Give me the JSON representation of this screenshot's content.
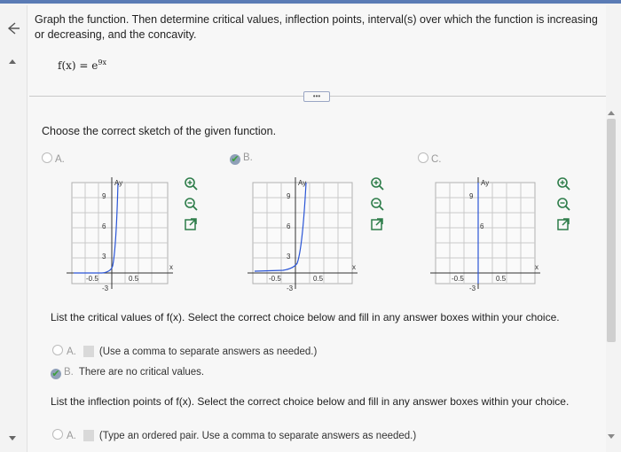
{
  "question_text": "Graph the function. Then determine critical values, inflection points, interval(s) over which the function is increasing or decreasing, and the concavity.",
  "function": {
    "base": "f(x) = e",
    "exponent": "9x"
  },
  "more_button": "•••",
  "sketch_prompt": "Choose the correct sketch of the given function.",
  "sketch_options": [
    {
      "letter": "A.",
      "selected": false
    },
    {
      "letter": "B.",
      "selected": true
    },
    {
      "letter": "C.",
      "selected": false
    }
  ],
  "graph_labels": {
    "y_top": "9",
    "y_mid": "6",
    "y_low": "3",
    "y_neg": "-3",
    "x_neg": "-0.5",
    "x_pos": "0.5",
    "x_axis": "x",
    "y_axis": "Ay"
  },
  "critical_prompt": "List the critical values of f(x). Select the correct choice below and fill in any answer boxes within your choice.",
  "critical_choices": [
    {
      "letter": "A.",
      "text": "(Use a comma to separate answers as needed.)"
    },
    {
      "letter": "B.",
      "text": "There are no critical values."
    }
  ],
  "inflection_prompt": "List the inflection points of f(x). Select the correct choice below and fill in any answer boxes within your choice.",
  "inflection_choices": [
    {
      "letter": "A.",
      "text": "(Type an ordered pair. Use a comma to separate answers as needed.)"
    }
  ],
  "colors": {
    "curve": "#2a55d6",
    "grid": "#c8c8c8",
    "check": "#3ca03c"
  }
}
